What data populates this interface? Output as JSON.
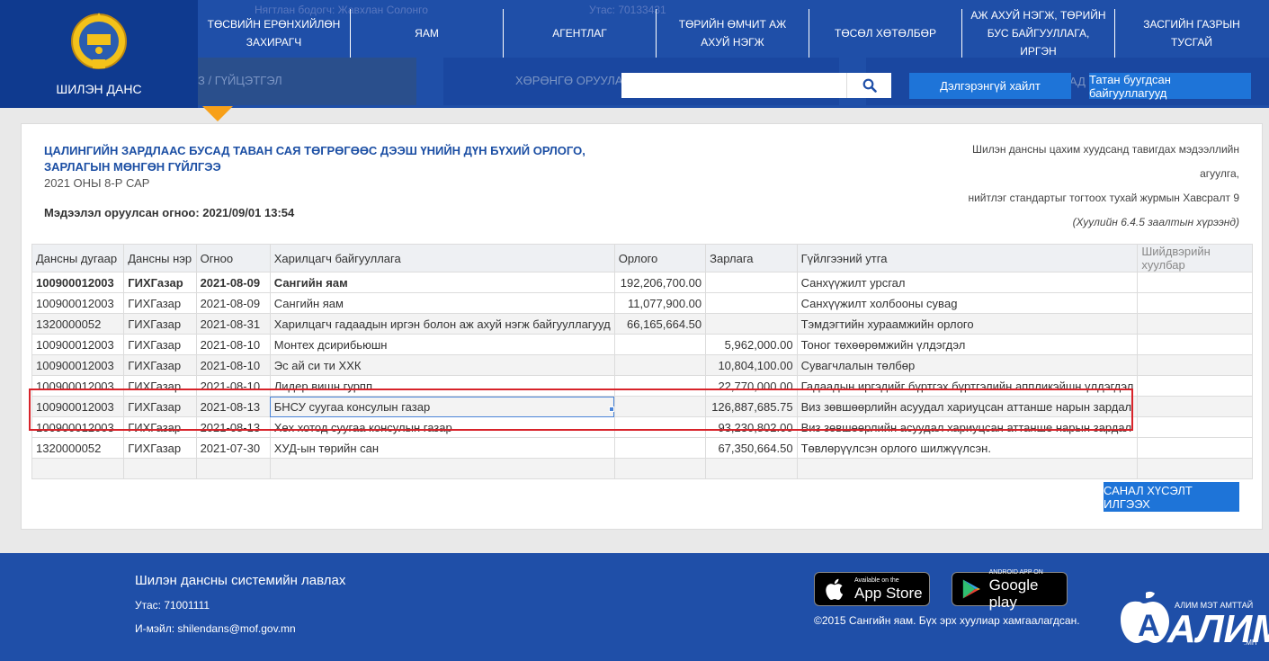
{
  "header": {
    "logo_text": "ШИЛЭН ДАНС",
    "ghost_text_1": "Нягтлан бодогч: Жавхлан Солонго",
    "ghost_text_2": "Утас: 70133431",
    "nav": [
      {
        "label": "ТӨСВИЙН ЕРӨНХИЙЛӨН ЗАХИРАГЧ"
      },
      {
        "label": "ЯАМ"
      },
      {
        "label": "АГЕНТЛАГ"
      },
      {
        "label": "ТӨРИЙН ӨМЧИТ АЖ АХУЙ НЭГЖ"
      },
      {
        "label": "ТӨСӨЛ ХӨТӨЛБӨР"
      },
      {
        "label": "АЖ АХУЙ НЭГЖ, ТӨРИЙН БУС БАЙГУУЛЛАГА, ИРГЭН"
      },
      {
        "label": "ЗАСГИЙН ГАЗРЫН ТУСГАЙ"
      }
    ],
    "ghost_sub_1": "З / ГҮЙЦЭТГЭЛ",
    "ghost_sub_2": "ХӨРӨНГӨ ОРУУЛАЛТ",
    "ghost_sub_3": "АД",
    "search_placeholder": "",
    "advanced_search": "Дэлгэрэнгүй хайлт",
    "grant_orgs": "Татан буугдсан байгууллагууд",
    "accent": "#f7a019",
    "brand": "#1f4fa8"
  },
  "report": {
    "title": "ЦАЛИНГИЙН ЗАРДЛААС БУСАД ТАВАН САЯ ТӨГРӨГӨӨС ДЭЭШ ҮНИЙН ДҮН БҮХИЙ ОРЛОГО, ЗАРЛАГЫН МӨНГӨН ГҮЙЛГЭЭ",
    "subtitle": "2021 ОНЫ 8-Р САР",
    "updated": "Мэдээлэл оруулсан огноо: 2021/09/01 13:54",
    "right_line1": "Шилэн дансны цахим хуудсанд тавигдах мэдээллийн агуулга,",
    "right_line2": "нийтлэг стандартыг тогтоох тухай журмын Хавсралт 9",
    "right_line3": "(Хуулийн 6.4.5 заалтын хүрээнд)"
  },
  "table": {
    "columns": [
      "Дансны дугаар",
      "Дансны нэр",
      "Огноо",
      "Харилцагч байгууллага",
      "Орлого",
      "Зарлага",
      "Гүйлгээний утга",
      "Шийдвэрийн хуулбар"
    ],
    "rows": [
      [
        "100900012003",
        "ГИХГазар",
        "2021-08-09",
        "Сангийн яам",
        "192,206,700.00",
        "",
        "Санхүүжилт урсгал",
        ""
      ],
      [
        "100900012003",
        "ГИХГазар",
        "2021-08-09",
        "Сангийн яам",
        "11,077,900.00",
        "",
        "Санхүүжилт холбооны сувag",
        ""
      ],
      [
        "1320000052",
        "ГИХГазар",
        "2021-08-31",
        "Харилцагч гадаадын иргэн болон аж ахуй нэгж байгууллагууд",
        "66,165,664.50",
        "",
        "Тэмдэгтийн хураамжийн орлого",
        ""
      ],
      [
        "100900012003",
        "ГИХГазар",
        "2021-08-10",
        "Монтех дсирибьюшн",
        "",
        "5,962,000.00",
        "Тоног төхөөрөмжийн үлдэгдэл",
        ""
      ],
      [
        "100900012003",
        "ГИХГазар",
        "2021-08-10",
        "Эс ай си ти ХХК",
        "",
        "10,804,100.00",
        "Сувагчлалын төлбөр",
        ""
      ],
      [
        "100900012003",
        "ГИХГазар",
        "2021-08-10",
        "Лидер вишн гурпп",
        "",
        "22,770,000.00",
        "Гадаадын иргэдийг бүртгэх бүртгэлийн аппликэйшн үлдэгдэл",
        ""
      ],
      [
        "100900012003",
        "ГИХГазар",
        "2021-08-13",
        "БНСУ суугаа консулын газар",
        "",
        "126,887,685.75",
        "Виз зөвшөөрлийн асуудал хариуцсан аттанше нарын зардал",
        ""
      ],
      [
        "100900012003",
        "ГИХГазар",
        "2021-08-13",
        "Хөх хотод суугаа консулын газар",
        "",
        "93,230,802.00",
        "Виз зөвшөөрлийн асуудал хариуцсан аттанше нарын зардал",
        ""
      ],
      [
        "1320000052",
        "ГИХГазар",
        "2021-07-30",
        "ХУД-ын төрийн сан",
        "",
        "67,350,664.50",
        "Төвлөрүүлсэн орлого шилжүүлсэн.",
        ""
      ],
      [
        "",
        "",
        "",
        "",
        "",
        "",
        "",
        ""
      ]
    ]
  },
  "feedback_button": "САНАЛ ХҮСЭЛТ ИЛГЭЭХ",
  "footer": {
    "title": "Шилэн дансны системийн лавлах",
    "phone": "Утас: 71001111",
    "email": "И-мэйл: shilendans@mof.gov.mn",
    "app_store_small": "Available on the",
    "app_store_big": "App Store",
    "play_small": "ANDROID APP ON",
    "play_big": "Google play",
    "copyright": "©2015 Сангийн яам. Бүх эрх хуулиар хамгаалагдсан.",
    "alim_tag": "АЛИМ МЭТ АМТТАЙ",
    "alim_name": "АЛИМ",
    "alim_domain": ".МН"
  }
}
